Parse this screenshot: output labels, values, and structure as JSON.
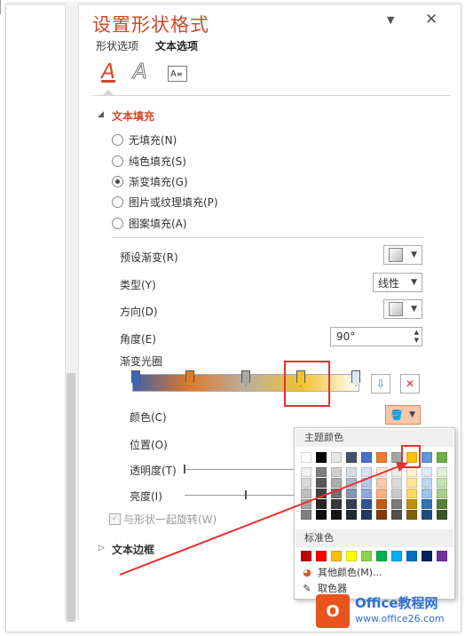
{
  "header": {
    "title": "设置形状格式",
    "tabs": [
      "形状选项",
      "文本选项"
    ],
    "pin_icon": "dropdown-arrow-icon",
    "close_icon": "close-icon"
  },
  "format_icons": {
    "text_fill_outline": "A",
    "text_effects": "A",
    "textbox": "A"
  },
  "text_fill": {
    "title": "文本填充",
    "options": [
      "无填充(N)",
      "纯色填充(S)",
      "渐变填充(G)",
      "图片或纹理填充(P)",
      "图案填充(A)"
    ],
    "selected_index": 2
  },
  "gradient": {
    "preset_label": "预设渐变(R)",
    "type_label": "类型(Y)",
    "type_value": "线性",
    "direction_label": "方向(D)",
    "angle_label": "角度(E)",
    "angle_value": "90°",
    "stops_label": "渐变光圈",
    "stop_colors": [
      "#3e66b8",
      "#e07b2a",
      "#a9a9a9",
      "#f2c12e",
      "#dde6f5"
    ],
    "selected_stop": 3,
    "color_label": "颜色(C)",
    "position_label": "位置(O)",
    "transparency_label": "透明度(T)",
    "brightness_label": "亮度(I)",
    "brightness_fraction": 0.55,
    "rotate_with_shape": "与形状一起旋转(W)",
    "rotate_checked": true
  },
  "text_border": {
    "title": "文本边框"
  },
  "color_picker": {
    "theme_title": "主题颜色",
    "theme_top": [
      "#ffffff",
      "#000000",
      "#e7e6e6",
      "#44546a",
      "#4472c4",
      "#ed7d31",
      "#a5a5a5",
      "#ffc000",
      "#5b9bd5",
      "#70ad47"
    ],
    "theme_shades": [
      [
        "#f2f2f2",
        "#d9d9d9",
        "#bfbfbf",
        "#a6a6a6",
        "#808080"
      ],
      [
        "#7f7f7f",
        "#595959",
        "#404040",
        "#262626",
        "#0d0d0d"
      ],
      [
        "#d0cece",
        "#aeabab",
        "#757171",
        "#3a3838",
        "#171616"
      ],
      [
        "#d6dce4",
        "#adb9ca",
        "#8497b0",
        "#333f4f",
        "#222a35"
      ],
      [
        "#d9e2f3",
        "#b4c6e7",
        "#8eaadb",
        "#2f5496",
        "#1f3864"
      ],
      [
        "#fbe5d5",
        "#f7caac",
        "#f4b183",
        "#c55a11",
        "#843c0b"
      ],
      [
        "#ededed",
        "#dbdbdb",
        "#c9c9c9",
        "#7b7b7b",
        "#525252"
      ],
      [
        "#fff2cc",
        "#ffe599",
        "#ffd966",
        "#bf9000",
        "#7f6000"
      ],
      [
        "#deebf6",
        "#bdd7ee",
        "#9dc3e6",
        "#2e75b5",
        "#1f4e79"
      ],
      [
        "#e2efd9",
        "#c5e0b3",
        "#a8d08d",
        "#538135",
        "#375623"
      ]
    ],
    "selected_theme_index": 7,
    "standard_title": "标准色",
    "standard": [
      "#c00000",
      "#ff0000",
      "#ffc000",
      "#ffff00",
      "#92d050",
      "#00b050",
      "#00b0f0",
      "#0070c0",
      "#002060",
      "#7030a0"
    ],
    "more_colors": "其他颜色(M)...",
    "eyedropper": "取色器"
  },
  "watermark": {
    "brand": "Office教程网",
    "url": "www.office26.com"
  }
}
